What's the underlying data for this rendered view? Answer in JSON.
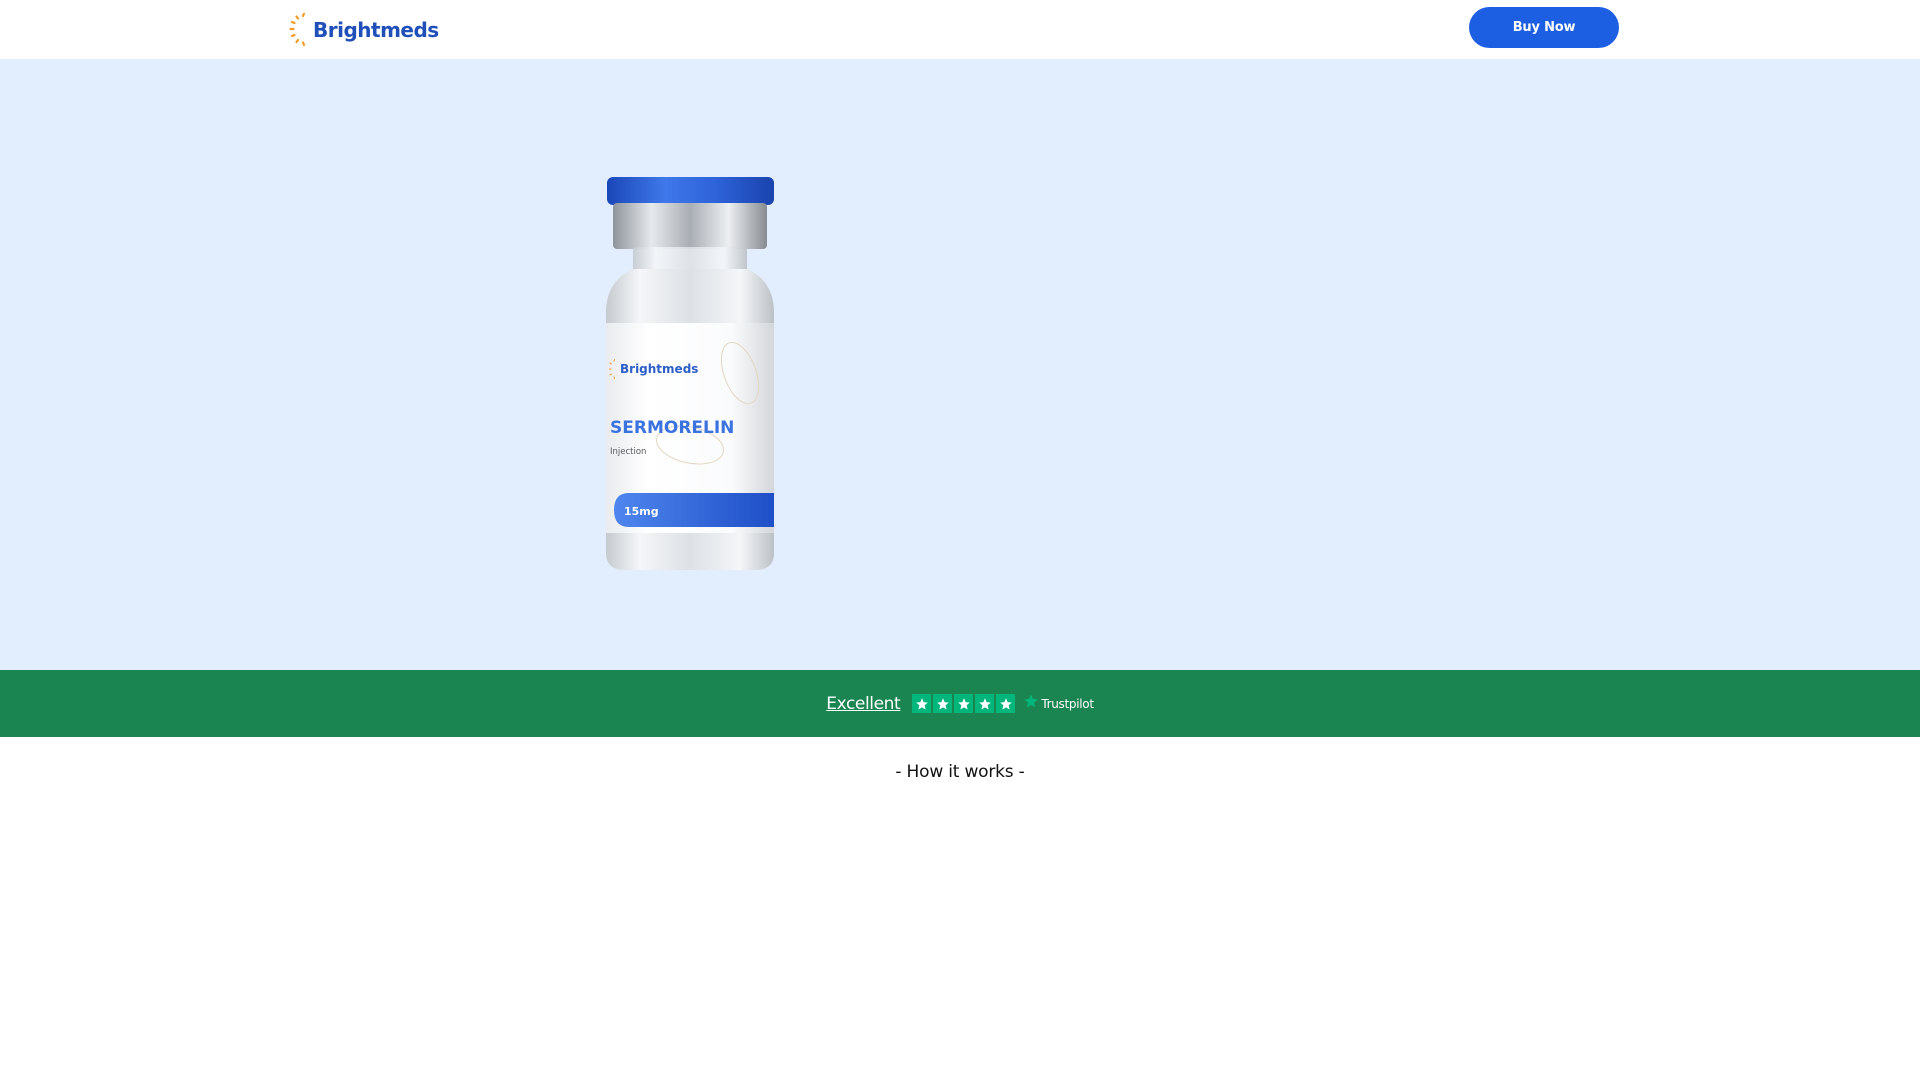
{
  "header": {
    "logo_text": "Brightmeds",
    "buy_button_label": "Buy Now"
  },
  "hero": {
    "product": {
      "brand": "Brightmeds",
      "name": "SERMORELIN",
      "form": "Injection",
      "dose": "15mg"
    }
  },
  "trust_bar": {
    "rating_label": "Excellent",
    "stars_count": 5,
    "provider": "Trustpilot"
  },
  "how_it_works": {
    "title": "- How it works -"
  },
  "colors": {
    "brand_blue": "#1d5fe3",
    "hero_bg": "#e2eefd",
    "trust_green": "#1a8550",
    "trustpilot_star": "#00b67a",
    "logo_orange": "#f59b23"
  }
}
